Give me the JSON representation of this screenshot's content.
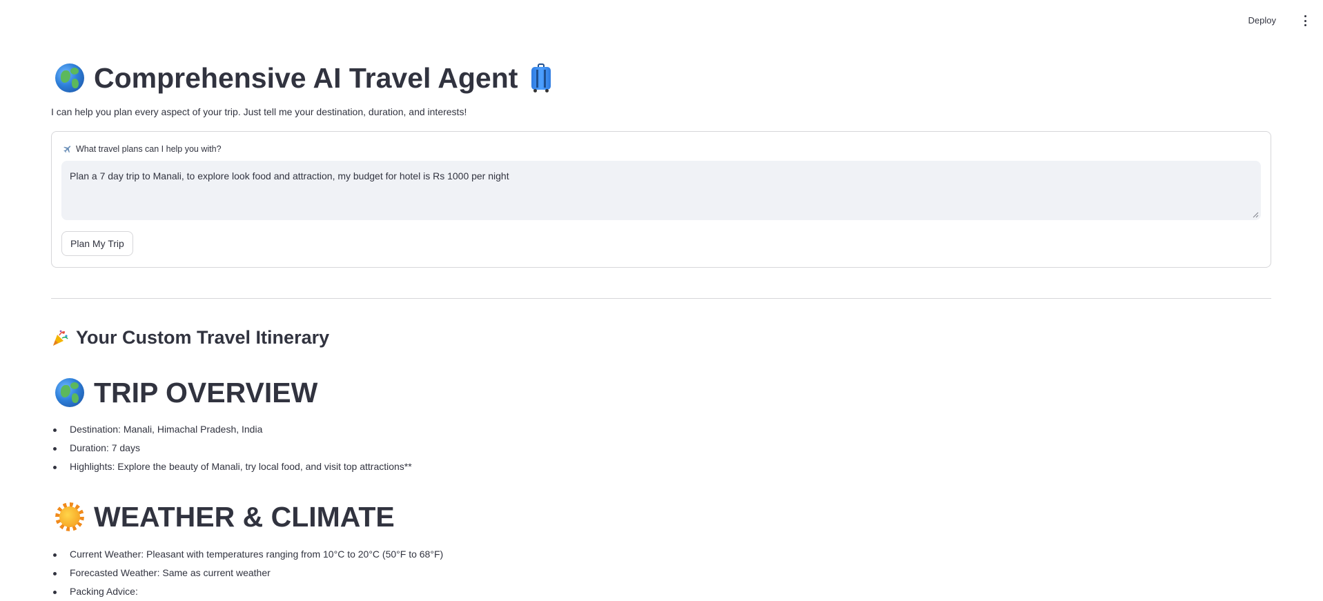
{
  "header": {
    "deploy_label": "Deploy"
  },
  "title": {
    "text": "Comprehensive AI Travel Agent",
    "left_icon": "globe-icon",
    "right_icon": "suitcase-icon"
  },
  "subtitle": "I can help you plan every aspect of your trip. Just tell me your destination, duration, and interests!",
  "form": {
    "field_label": "What travel plans can I help you with?",
    "field_icon": "airplane-icon",
    "input_value": "Plan a 7 day trip to Manali, to explore look food and attraction, my budget for hotel is Rs 1000 per night",
    "submit_label": "Plan My Trip"
  },
  "results": {
    "heading": "Your Custom Travel Itinerary",
    "heading_icon": "party-popper-icon",
    "sections": [
      {
        "title": "TRIP OVERVIEW",
        "icon": "globe-icon",
        "items": [
          "Destination: Manali, Himachal Pradesh, India",
          "Duration: 7 days",
          "Highlights: Explore the beauty of Manali, try local food, and visit top attractions**"
        ]
      },
      {
        "title": "WEATHER & CLIMATE",
        "icon": "sun-icon",
        "items": [
          "Current Weather: Pleasant with temperatures ranging from 10°C to 20°C (50°F to 68°F)",
          "Forecasted Weather: Same as current weather",
          "Packing Advice:"
        ]
      }
    ]
  },
  "colors": {
    "text": "#31333f",
    "input_bg": "#f0f2f6",
    "border": "#d6d6d9"
  }
}
